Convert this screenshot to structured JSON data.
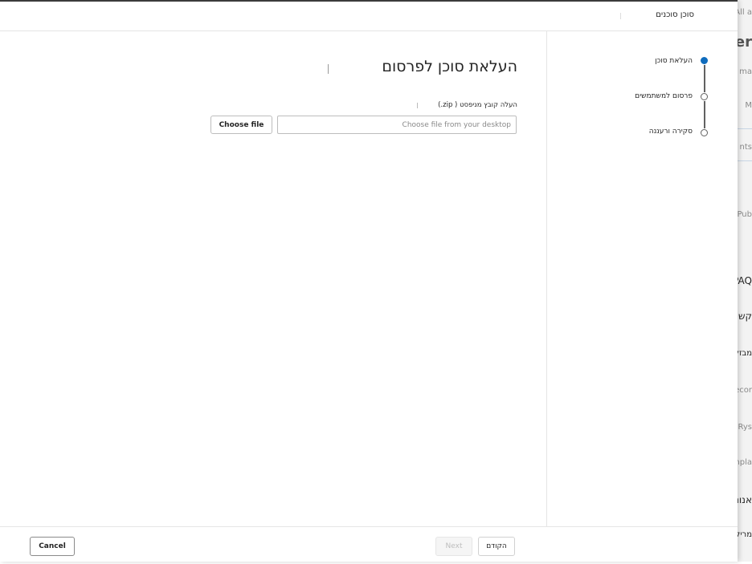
{
  "dialog": {
    "title": "סוכן סוכנים"
  },
  "steps": [
    {
      "label": "העלאת סוכן",
      "state": "active"
    },
    {
      "label": "פרסום למשתמשים",
      "state": "inactive"
    },
    {
      "label": "סקירה ורעננה",
      "state": "inactive"
    }
  ],
  "main": {
    "heading": "העלאת סוכן לפרסום",
    "upload_label": "העלה קובץ מניפסט ( zip.)",
    "file_input_placeholder": "Choose file from your desktop",
    "choose_button_label": "Choose file"
  },
  "footer": {
    "previous_label": "הקודם",
    "next_label": "Next",
    "cancel_label": "Cancel"
  },
  "background_app": {
    "fragments": [
      "All a",
      "er",
      "ma",
      "M",
      "nts (",
      "Pub",
      "iPAQ",
      "קשתית",
      "מבזק",
      "ecor",
      "eRys",
      "npla",
      "אנונימי",
      "מריל"
    ]
  },
  "colors": {
    "accent": "#0f6cbd",
    "border": "#e5e5e5",
    "text": "#242424"
  }
}
